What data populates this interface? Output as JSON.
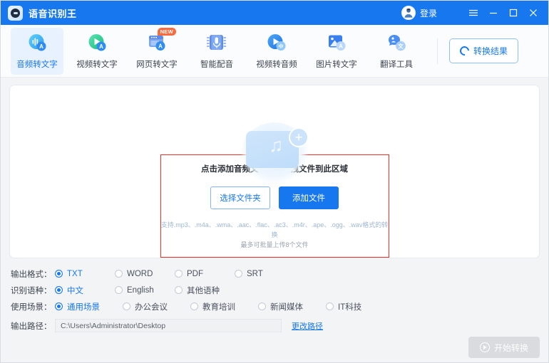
{
  "titlebar": {
    "app_name": "语音识别王",
    "logo_icon": "app-logo-icon",
    "account_label": "登录",
    "avatar_icon": "avatar-icon",
    "menu_icon": "hamburger-menu-icon",
    "minimize_icon": "minimize-icon",
    "maximize_icon": "maximize-icon",
    "close_icon": "close-icon",
    "bg_color": "#1677ee"
  },
  "toolbar": {
    "items": [
      {
        "label": "音频转文字",
        "icon": "audio-to-text-icon",
        "active": true,
        "badge": ""
      },
      {
        "label": "视频转文字",
        "icon": "video-to-text-icon",
        "active": false,
        "badge": ""
      },
      {
        "label": "网页转文字",
        "icon": "webpage-to-text-icon",
        "active": false,
        "badge": "NEW"
      },
      {
        "label": "智能配音",
        "icon": "smart-dubbing-icon",
        "active": false,
        "badge": ""
      },
      {
        "label": "视频转音频",
        "icon": "video-to-audio-icon",
        "active": false,
        "badge": ""
      },
      {
        "label": "图片转文字",
        "icon": "image-to-text-icon",
        "active": false,
        "badge": ""
      },
      {
        "label": "翻译工具",
        "icon": "translate-tool-icon",
        "active": false,
        "badge": ""
      }
    ],
    "result_button": {
      "label": "转换结果",
      "icon": "refresh-circle-icon"
    }
  },
  "dropzone": {
    "illustration_icon": "audio-file-add-icon",
    "title_prefix": "点击添加音频文件",
    "title_or": "或",
    "title_suffix": "拖拽文件到此区域",
    "choose_folder_label": "选择文件夹",
    "add_file_label": "添加文件",
    "formats_note": "支持.mp3、.m4a、.wma、.aac、.flac、.ac3、.m4r、.ape、.ogg、.wav格式的转换",
    "limit_note": "最多可批量上传8个文件",
    "highlight_color": "#ef2f23"
  },
  "settings": {
    "output_format": {
      "label": "输出格式：",
      "options": [
        "TXT",
        "WORD",
        "PDF",
        "SRT"
      ],
      "selected": "TXT"
    },
    "language": {
      "label": "识别语种：",
      "options": [
        "中文",
        "English",
        "其他语种"
      ],
      "selected": "中文"
    },
    "scene": {
      "label": "使用场景：",
      "options": [
        "通用场景",
        "办公会议",
        "教育培训",
        "新闻媒体",
        "IT科技"
      ],
      "selected": "通用场景"
    },
    "output_path": {
      "label": "输出路径：",
      "value": "C:\\Users\\Administrator\\Desktop",
      "change_link": "更改路径"
    }
  },
  "footer": {
    "start_button": {
      "label": "开始转换",
      "icon": "play-circle-icon",
      "disabled": true
    }
  }
}
